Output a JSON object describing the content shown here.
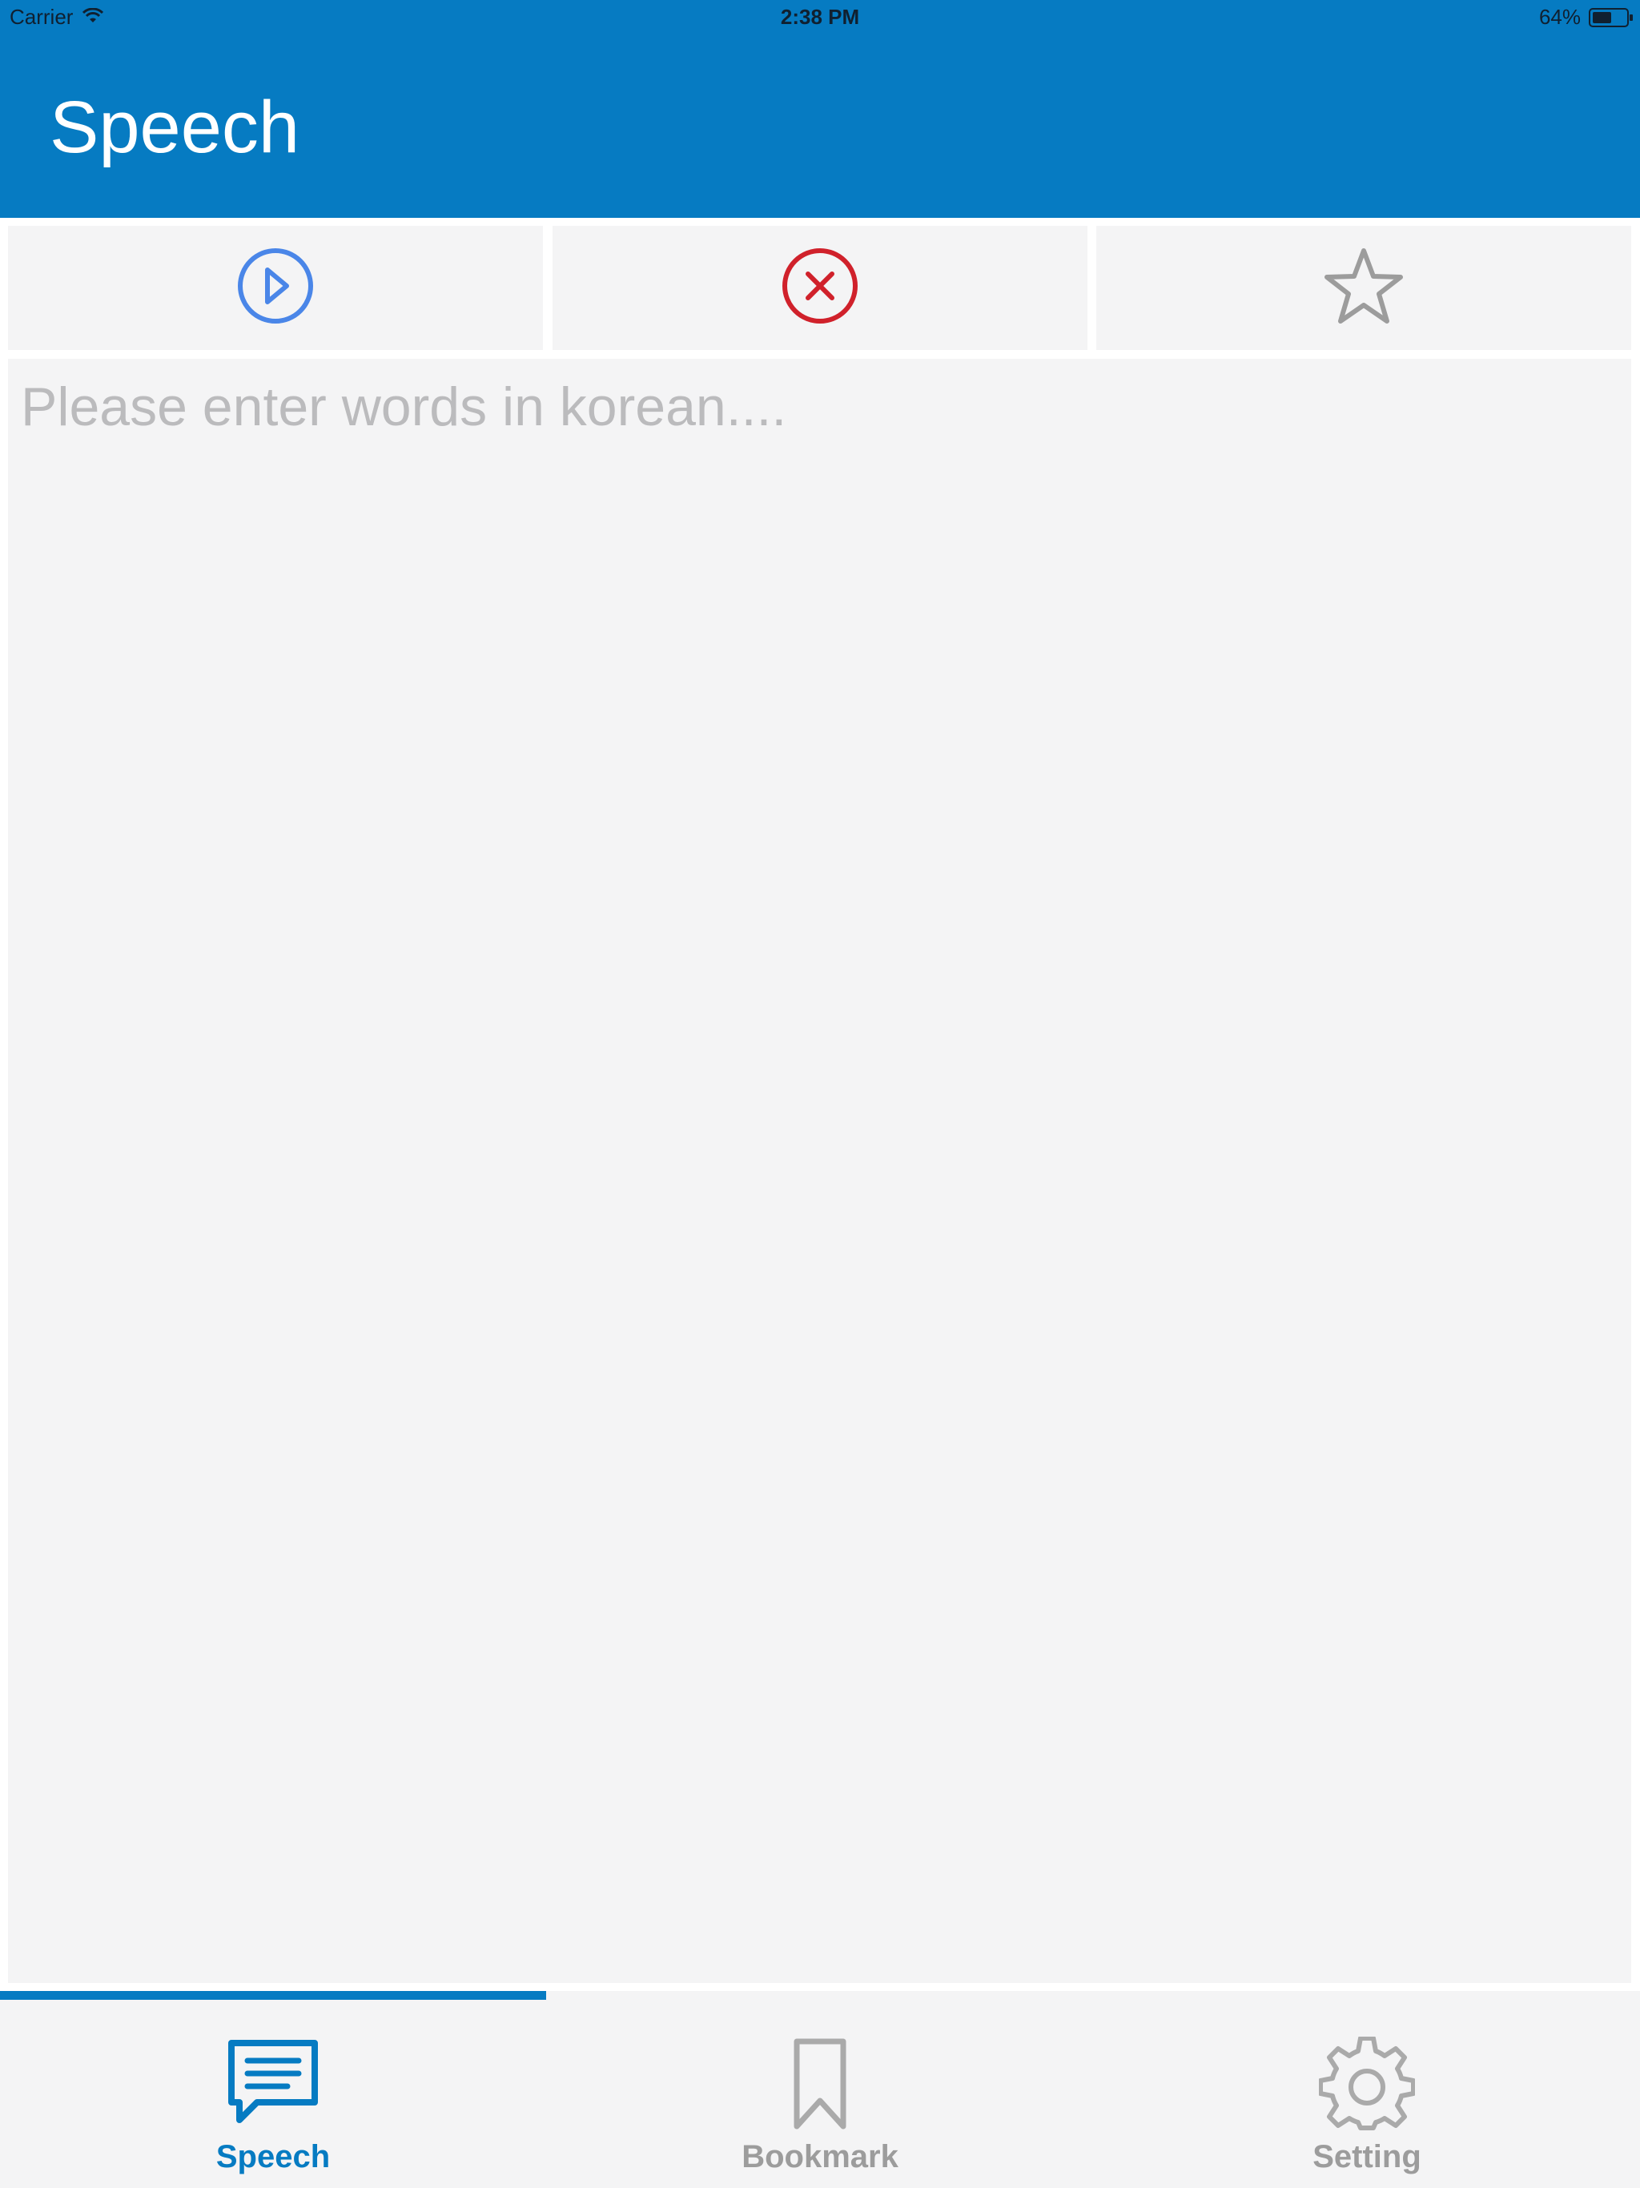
{
  "status_bar": {
    "carrier": "Carrier",
    "time": "2:38 PM",
    "battery_text": "64%",
    "battery_level": 0.64
  },
  "header": {
    "title": "Speech"
  },
  "toolbar": {
    "play_icon": "play-circle-icon",
    "clear_icon": "close-circle-icon",
    "bookmark_icon": "star-outline-icon"
  },
  "editor": {
    "placeholder": "Please enter words in korean....",
    "value": ""
  },
  "tabbar": {
    "active_index": 0,
    "tabs": [
      {
        "label": "Speech",
        "icon": "chat-bubble-icon"
      },
      {
        "label": "Bookmark",
        "icon": "bookmark-icon"
      },
      {
        "label": "Setting",
        "icon": "gear-icon"
      }
    ]
  },
  "colors": {
    "primary": "#067bc2",
    "play": "#4a86e8",
    "clear": "#d0212b",
    "inactive": "#9c9c9c",
    "surface": "#f4f4f5"
  }
}
